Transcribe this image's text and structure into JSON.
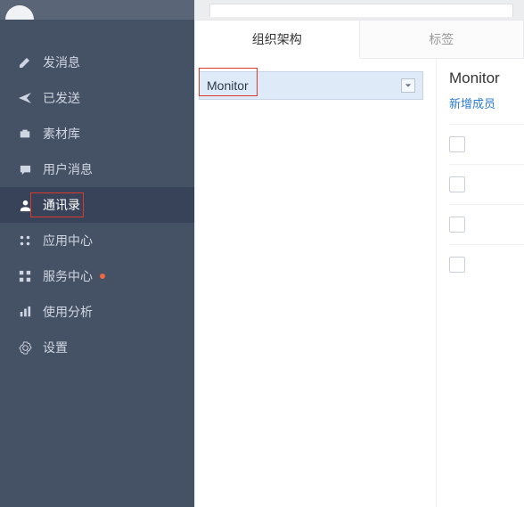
{
  "sidebar": {
    "items": [
      {
        "id": "compose",
        "label": "发消息"
      },
      {
        "id": "sent",
        "label": "已发送"
      },
      {
        "id": "assets",
        "label": "素材库"
      },
      {
        "id": "user-msgs",
        "label": "用户消息"
      },
      {
        "id": "contacts",
        "label": "通讯录"
      },
      {
        "id": "apps",
        "label": "应用中心"
      },
      {
        "id": "services",
        "label": "服务中心",
        "dot": true
      },
      {
        "id": "analytics",
        "label": "使用分析"
      },
      {
        "id": "settings",
        "label": "设置"
      }
    ],
    "active_index": 4
  },
  "tabs": {
    "items": [
      "组织架构",
      "标签"
    ],
    "active_index": 0
  },
  "org_dropdown": {
    "selected": "Monitor"
  },
  "right_panel": {
    "title": "Monitor",
    "add_member_label": "新增成员",
    "row_count": 4
  }
}
